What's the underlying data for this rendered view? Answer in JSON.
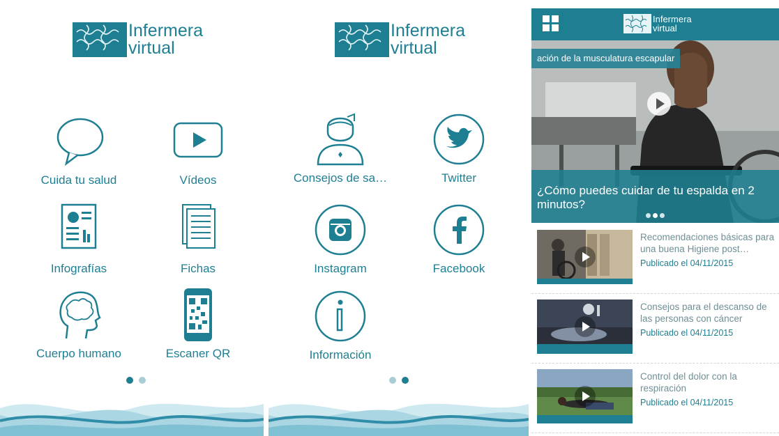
{
  "logo": {
    "line1": "Infermera",
    "line2": "virtual"
  },
  "screen1": {
    "tiles": [
      {
        "label": "Cuida tu salud",
        "icon": "speech-bubble-icon"
      },
      {
        "label": "Vídeos",
        "icon": "video-play-icon"
      },
      {
        "label": "Infografías",
        "icon": "infographic-icon"
      },
      {
        "label": "Fichas",
        "icon": "documents-icon"
      },
      {
        "label": "Cuerpo humano",
        "icon": "brain-head-icon"
      },
      {
        "label": "Escaner QR",
        "icon": "qr-phone-icon"
      }
    ],
    "page_index": 1,
    "page_count": 2
  },
  "screen2": {
    "tiles": [
      {
        "label": "Consejos de sa…",
        "icon": "nurse-icon"
      },
      {
        "label": "Twitter",
        "icon": "twitter-icon"
      },
      {
        "label": "Instagram",
        "icon": "instagram-icon"
      },
      {
        "label": "Facebook",
        "icon": "facebook-icon"
      },
      {
        "label": "Información",
        "icon": "info-icon"
      }
    ],
    "page_index": 2,
    "page_count": 2
  },
  "screen3": {
    "header_logo": {
      "line1": "Infermera",
      "line2": "virtual"
    },
    "hero": {
      "banner": "ación de la musculatura escapular",
      "title": "¿Cómo puedes cuidar de tu espalda en 2 minutos?",
      "slide_index": 2,
      "slide_count": 3
    },
    "news": [
      {
        "title": "Recomendaciones básicas para una buena Higiene post…",
        "date": "Publicado el 04/11/2015"
      },
      {
        "title": "Consejos para el descanso de las personas con cáncer",
        "date": "Publicado el 04/11/2015"
      },
      {
        "title": "Control del dolor con la respiración",
        "date": "Publicado el 04/11/2015"
      }
    ]
  },
  "colors": {
    "brand": "#1e7f92",
    "wave_light": "#a9d6e2",
    "wave_dark": "#2f8da8"
  }
}
